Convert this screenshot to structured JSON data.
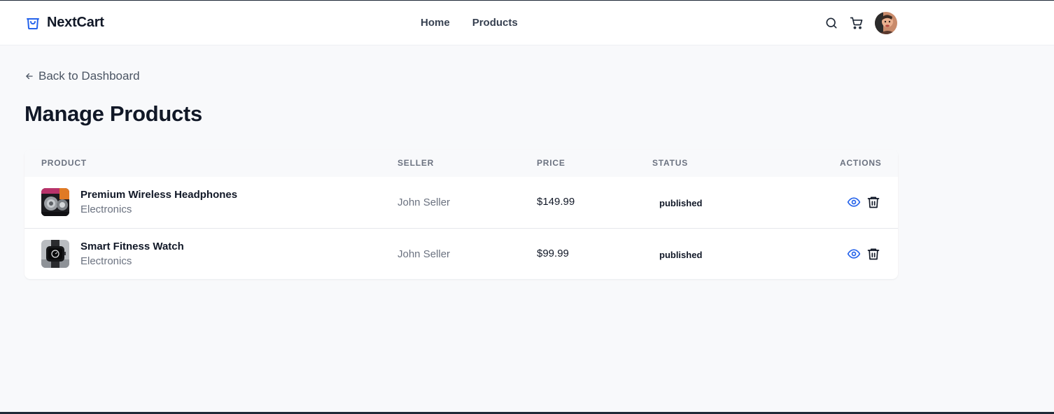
{
  "header": {
    "brand": "NextCart",
    "nav": [
      "Home",
      "Products"
    ]
  },
  "back_link": "Back to Dashboard",
  "page_title": "Manage Products",
  "table": {
    "columns": [
      "PRODUCT",
      "SELLER",
      "PRICE",
      "STATUS",
      "ACTIONS"
    ],
    "rows": [
      {
        "name": "Premium Wireless Headphones",
        "category": "Electronics",
        "seller": "John Seller",
        "price": "$149.99",
        "status": "published"
      },
      {
        "name": "Smart Fitness Watch",
        "category": "Electronics",
        "seller": "John Seller",
        "price": "$99.99",
        "status": "published"
      }
    ]
  },
  "icons": {
    "brand": "shopping-bag-icon",
    "search": "search-icon",
    "cart": "shopping-cart-icon",
    "back": "arrow-left-icon",
    "view": "eye-icon",
    "delete": "trash-icon"
  },
  "colors": {
    "brand_accent": "#2563eb",
    "view_action": "#2563eb",
    "page_background": "#f8f9fb"
  }
}
